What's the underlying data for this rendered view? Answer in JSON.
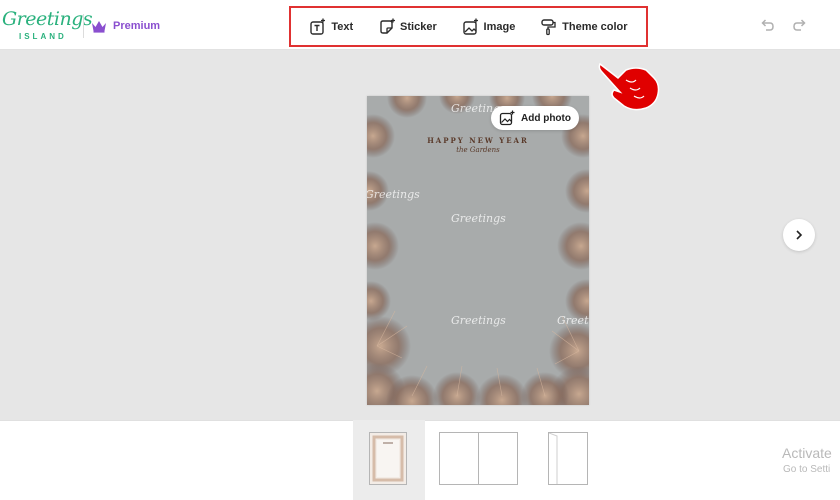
{
  "header": {
    "logo_script": "Greetings",
    "logo_sub": "ISLAND",
    "premium_label": "Premium"
  },
  "toolbar": {
    "items": [
      {
        "label": "Text",
        "icon": "text-icon"
      },
      {
        "label": "Sticker",
        "icon": "sticker-icon"
      },
      {
        "label": "Image",
        "icon": "image-icon"
      },
      {
        "label": "Theme color",
        "icon": "paint-roller-icon"
      }
    ]
  },
  "card": {
    "title": "HAPPY NEW YEAR",
    "subtitle": "the Gardens",
    "add_photo_label": "Add photo",
    "watermark": "Greetings"
  },
  "windows": {
    "activate_title": "Activate",
    "activate_sub": "Go to Setti"
  },
  "colors": {
    "brand_green": "#2ab17d",
    "premium_purple": "#8a4fcf",
    "highlight_red": "#e03131"
  }
}
